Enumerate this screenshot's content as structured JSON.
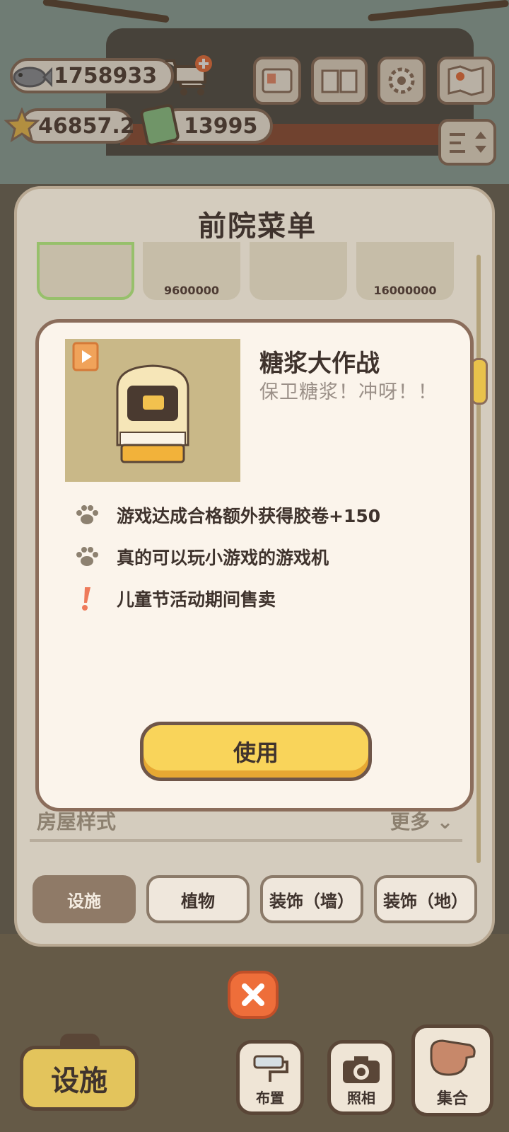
{
  "hud": {
    "fish_count": "1758933",
    "star_count": "46857.2",
    "film_count": "13995"
  },
  "panel": {
    "title": "前院菜单",
    "items": [
      {
        "price": ""
      },
      {
        "price": "9600000"
      },
      {
        "price": ""
      },
      {
        "price": "16000000"
      }
    ],
    "section_label": "房屋样式",
    "section_more": "更多",
    "tabs": [
      {
        "label": "设施",
        "active": true
      },
      {
        "label": "植物",
        "active": false
      },
      {
        "label": "装饰（墙）",
        "active": false
      },
      {
        "label": "装饰（地）",
        "active": false
      }
    ]
  },
  "card": {
    "title": "糖浆大作战",
    "subtitle": "保卫糖浆！冲呀！！",
    "features": [
      {
        "icon": "paw-icon",
        "text": "游戏达成合格额外获得胶卷+150"
      },
      {
        "icon": "paw-icon",
        "text": "真的可以玩小游戏的游戏机"
      },
      {
        "icon": "exclamation-icon",
        "text": "儿童节活动期间售卖"
      }
    ],
    "use_label": "使用"
  },
  "bottom": {
    "main_label": "设施",
    "layout_label": "布置",
    "photo_label": "照相",
    "gather_label": "集合"
  },
  "colors": {
    "accent_yellow": "#f9d45a",
    "close_orange": "#ee6e3a",
    "outline_brown": "#8b6d5b"
  }
}
